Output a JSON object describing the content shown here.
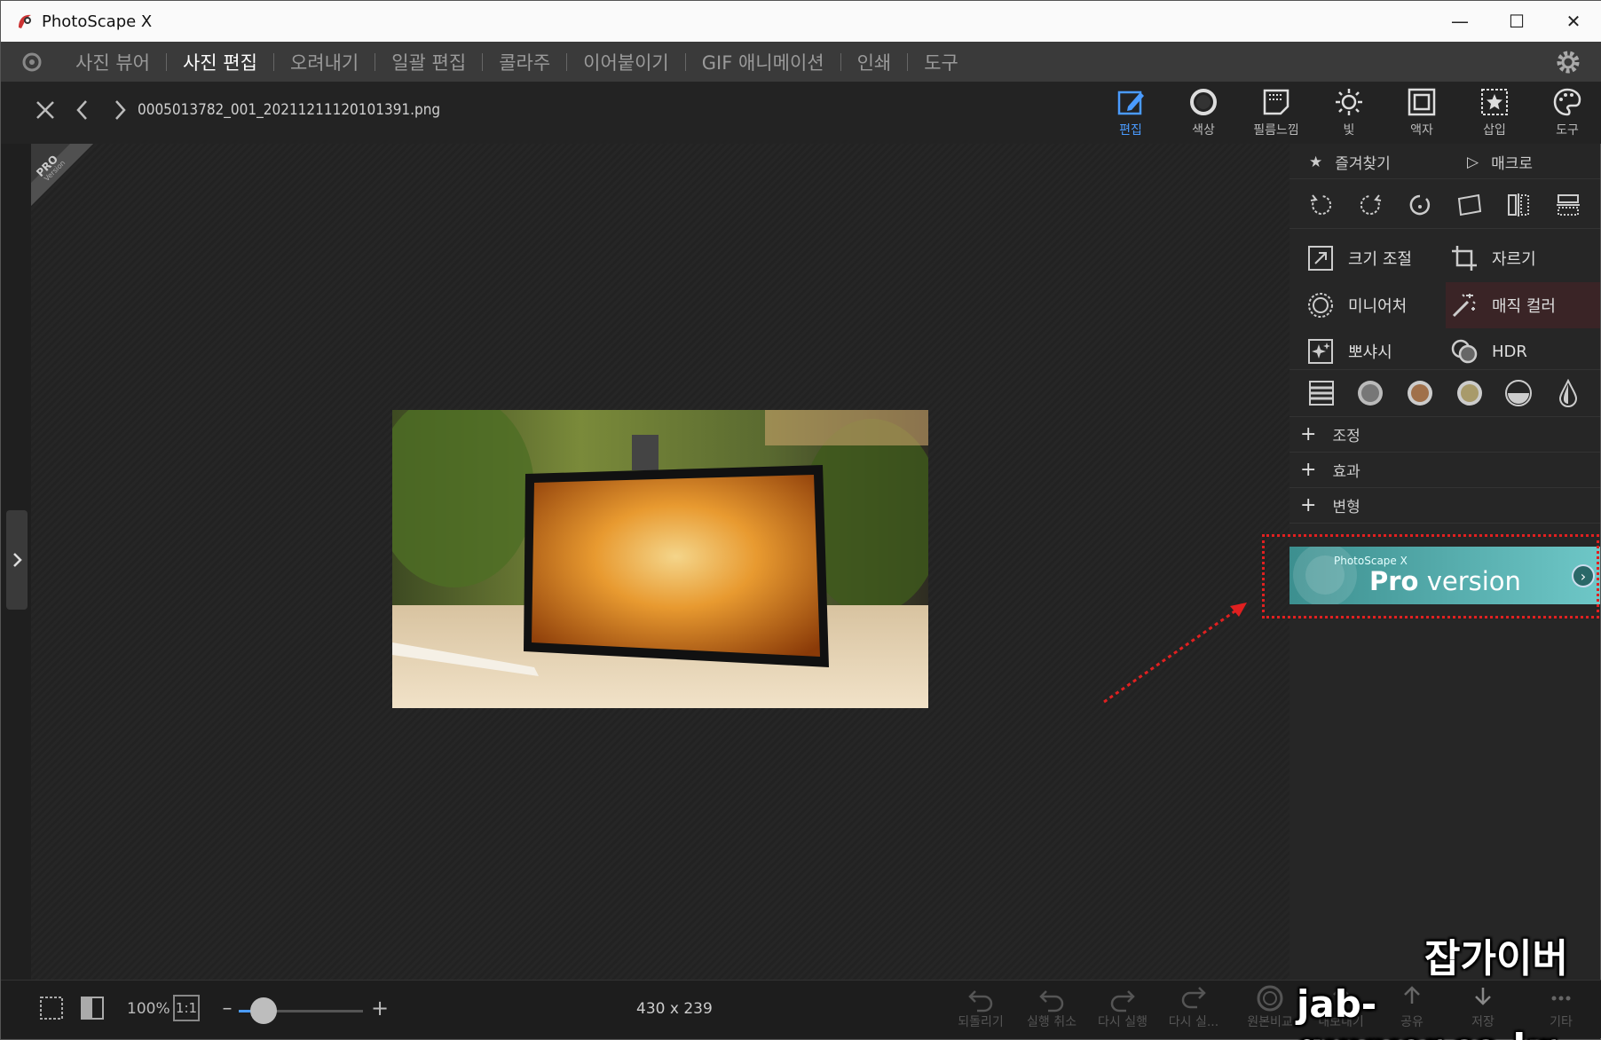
{
  "window": {
    "title": "PhotoScape X"
  },
  "menu": {
    "items": [
      "사진 뷰어",
      "사진 편집",
      "오려내기",
      "일괄 편집",
      "콜라주",
      "이어붙이기",
      "GIF 애니메이션",
      "인쇄",
      "도구"
    ],
    "active": "사진 편집"
  },
  "toolbar": {
    "filename": "0005013782_001_20211211120101391.png",
    "tabs": [
      "편집",
      "색상",
      "필름느낌",
      "빛",
      "액자",
      "삽입",
      "도구"
    ],
    "active_tab": "편집"
  },
  "sidepanel": {
    "favorites": "즐겨찾기",
    "macro": "매크로",
    "tools": [
      "크기 조절",
      "자르기",
      "미니어처",
      "매직 컬러",
      "뽀샤시",
      "HDR"
    ],
    "sections": [
      "조정",
      "효과",
      "변형"
    ]
  },
  "pro_banner": {
    "small": "PhotoScape X",
    "pro": "Pro",
    "version": "version"
  },
  "pro_corner": {
    "line1": "PRO",
    "line2": "Version"
  },
  "status": {
    "zoom": "100%",
    "ratio": "1:1",
    "zoom_slider": 0.2,
    "dimensions": "430 x 239",
    "actions": [
      "되돌리기",
      "실행 취소",
      "다시 실행",
      "다시 실...",
      "원본비교",
      "내보내기",
      "공유",
      "저장",
      "기타"
    ]
  },
  "watermark": {
    "line1": "잡가이버",
    "line2": "jab-guyver.co.kr"
  },
  "colors": {
    "accent": "#4a9bff",
    "highlight": "#e02020",
    "banner": "#5bb5b5"
  }
}
